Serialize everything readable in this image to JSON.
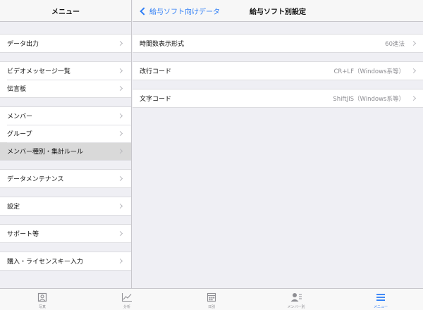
{
  "left": {
    "title": "メニュー",
    "groups": [
      [
        "データ出力"
      ],
      [
        "ビデオメッセージ一覧",
        "伝言板"
      ],
      [
        "メンバー",
        "グループ",
        "メンバー種別・集計ルール"
      ],
      [
        "データメンテナンス"
      ],
      [
        "設定"
      ],
      [
        "サポート等"
      ],
      [
        "購入・ライセンスキー入力"
      ]
    ],
    "selected": "メンバー種別・集計ルール"
  },
  "right": {
    "back_label": "給与ソフト向けデータ",
    "title": "給与ソフト別設定",
    "rows": [
      {
        "label": "時間数表示形式",
        "value": "60進法"
      },
      {
        "label": "改行コード",
        "value": "CR+LF（Windows系等）"
      },
      {
        "label": "文字コード",
        "value": "ShiftJIS（Windows系等）"
      }
    ]
  },
  "tabbar": {
    "tabs": [
      {
        "label": "写真",
        "icon": "photo-icon"
      },
      {
        "label": "分析",
        "icon": "chart-icon"
      },
      {
        "label": "日別",
        "icon": "calendar-icon"
      },
      {
        "label": "メンバー別",
        "icon": "members-icon"
      },
      {
        "label": "メニュー",
        "icon": "menu-icon"
      }
    ],
    "active_index": 4,
    "accent": "#2f7ef6"
  }
}
